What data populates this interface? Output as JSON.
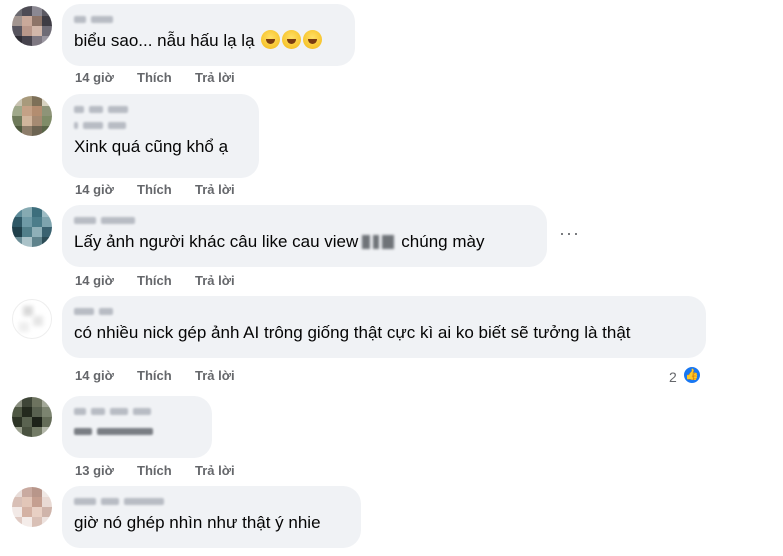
{
  "comments": [
    {
      "text": "biểu sao... nẫu hấu lạ lạ",
      "emoji_icons": [
        "grinning-squint-icon",
        "grinning-squint-icon",
        "grinning-squint-icon"
      ],
      "time": "14 giờ",
      "like": "Thích",
      "reply": "Trả lời"
    },
    {
      "text": "Xink quá cũng khổ ạ",
      "time": "14 giờ",
      "like": "Thích",
      "reply": "Trả lời"
    },
    {
      "text_before": "Lấy ảnh người khác câu like cau view",
      "text_after": "chúng mày",
      "time": "14 giờ",
      "like": "Thích",
      "reply": "Trả lời",
      "more_label": "···"
    },
    {
      "text": "có nhiều nick gép ảnh AI trông giống thật cực kì ai ko biết sẽ tưởng là thật",
      "time": "14 giờ",
      "like": "Thích",
      "reply": "Trả lời",
      "reaction_count": "2",
      "reaction_icon": "like-icon"
    },
    {
      "time": "13 giờ",
      "like": "Thích",
      "reply": "Trả lời"
    },
    {
      "text": "giờ nó ghép nhìn như thật ý nhie"
    }
  ],
  "colors": {
    "bubble": "#f0f2f5",
    "meta": "#65676b",
    "accent": "#1877f2"
  }
}
